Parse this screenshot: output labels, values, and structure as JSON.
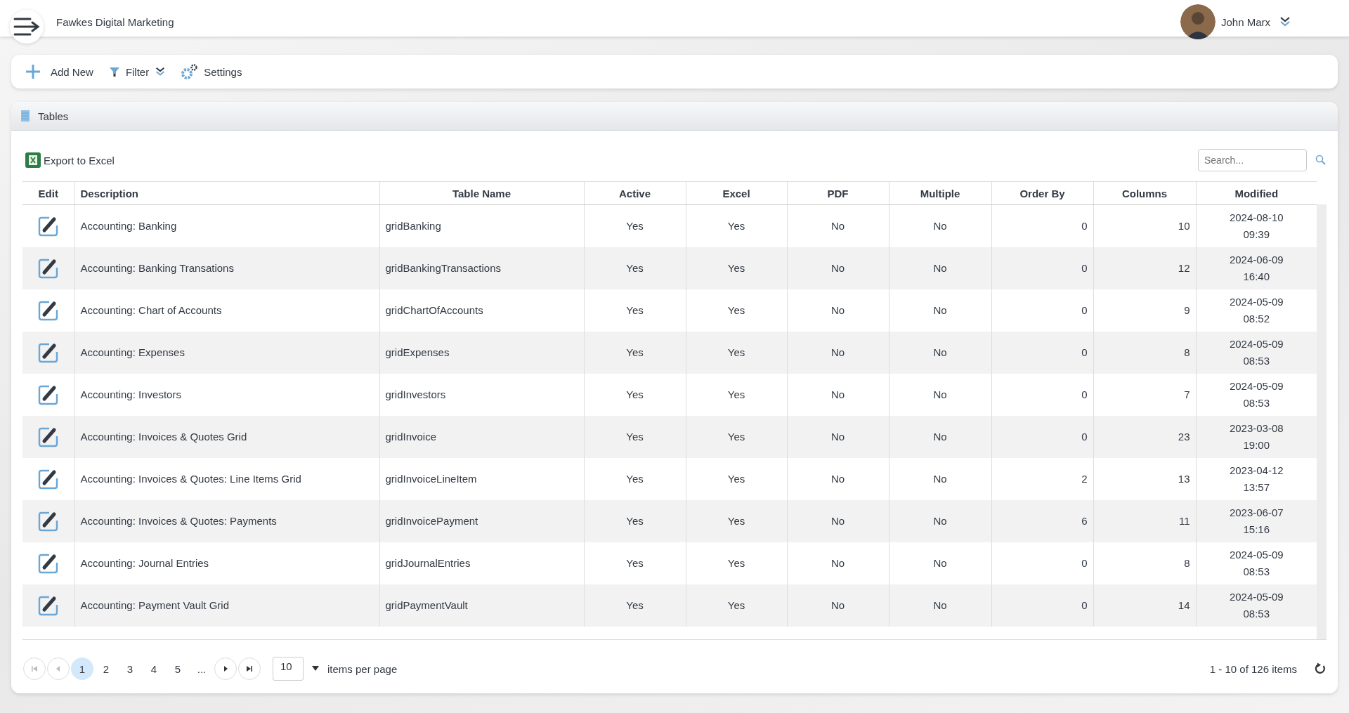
{
  "header": {
    "app_title": "Fawkes Digital Marketing",
    "user_name": "John Marx"
  },
  "toolbar": [
    {
      "kind": "add",
      "label": "Add New"
    },
    {
      "kind": "filter",
      "label": "Filter"
    },
    {
      "kind": "settings",
      "label": "Settings"
    }
  ],
  "panel": {
    "title": "Tables",
    "export_label": "Export to Excel",
    "search": {
      "placeholder": "Search..."
    }
  },
  "table": {
    "columns": [
      "Edit",
      "Description",
      "Table Name",
      "Active",
      "Excel",
      "PDF",
      "Multiple",
      "Order By",
      "Columns",
      "Modified"
    ],
    "rows": [
      {
        "description": "Accounting: Banking",
        "table_name": "gridBanking",
        "active": "Yes",
        "excel": "Yes",
        "pdf": "No",
        "multiple": "No",
        "order_by": "0",
        "columns": "10",
        "modified": [
          "2024-08-10",
          "09:39"
        ]
      },
      {
        "description": "Accounting: Banking Transations",
        "table_name": "gridBankingTransactions",
        "active": "Yes",
        "excel": "Yes",
        "pdf": "No",
        "multiple": "No",
        "order_by": "0",
        "columns": "12",
        "modified": [
          "2024-06-09",
          "16:40"
        ]
      },
      {
        "description": "Accounting: Chart of Accounts",
        "table_name": "gridChartOfAccounts",
        "active": "Yes",
        "excel": "Yes",
        "pdf": "No",
        "multiple": "No",
        "order_by": "0",
        "columns": "9",
        "modified": [
          "2024-05-09",
          "08:52"
        ]
      },
      {
        "description": "Accounting: Expenses",
        "table_name": "gridExpenses",
        "active": "Yes",
        "excel": "Yes",
        "pdf": "No",
        "multiple": "No",
        "order_by": "0",
        "columns": "8",
        "modified": [
          "2024-05-09",
          "08:53"
        ]
      },
      {
        "description": "Accounting: Investors",
        "table_name": "gridInvestors",
        "active": "Yes",
        "excel": "Yes",
        "pdf": "No",
        "multiple": "No",
        "order_by": "0",
        "columns": "7",
        "modified": [
          "2024-05-09",
          "08:53"
        ]
      },
      {
        "description": "Accounting: Invoices & Quotes Grid",
        "table_name": "gridInvoice",
        "active": "Yes",
        "excel": "Yes",
        "pdf": "No",
        "multiple": "No",
        "order_by": "0",
        "columns": "23",
        "modified": [
          "2023-03-08",
          "19:00"
        ]
      },
      {
        "description": "Accounting: Invoices & Quotes: Line Items Grid",
        "table_name": "gridInvoiceLineItem",
        "active": "Yes",
        "excel": "Yes",
        "pdf": "No",
        "multiple": "No",
        "order_by": "2",
        "columns": "13",
        "modified": [
          "2023-04-12",
          "13:57"
        ]
      },
      {
        "description": "Accounting: Invoices & Quotes: Payments",
        "table_name": "gridInvoicePayment",
        "active": "Yes",
        "excel": "Yes",
        "pdf": "No",
        "multiple": "No",
        "order_by": "6",
        "columns": "11",
        "modified": [
          "2023-06-07",
          "15:16"
        ]
      },
      {
        "description": "Accounting: Journal Entries",
        "table_name": "gridJournalEntries",
        "active": "Yes",
        "excel": "Yes",
        "pdf": "No",
        "multiple": "No",
        "order_by": "0",
        "columns": "8",
        "modified": [
          "2024-05-09",
          "08:53"
        ]
      },
      {
        "description": "Accounting: Payment Vault Grid",
        "table_name": "gridPaymentVault",
        "active": "Yes",
        "excel": "Yes",
        "pdf": "No",
        "multiple": "No",
        "order_by": "0",
        "columns": "14",
        "modified": [
          "2024-05-09",
          "08:53"
        ]
      }
    ]
  },
  "pagination": {
    "pages": [
      {
        "label": "1",
        "selected": true
      },
      {
        "label": "2",
        "selected": false
      },
      {
        "label": "3",
        "selected": false
      },
      {
        "label": "4",
        "selected": false
      },
      {
        "label": "5",
        "selected": false
      }
    ],
    "ellipsis": "...",
    "page_size": "10",
    "page_size_label": "items per page",
    "summary": "1 - 10 of 126 items"
  }
}
